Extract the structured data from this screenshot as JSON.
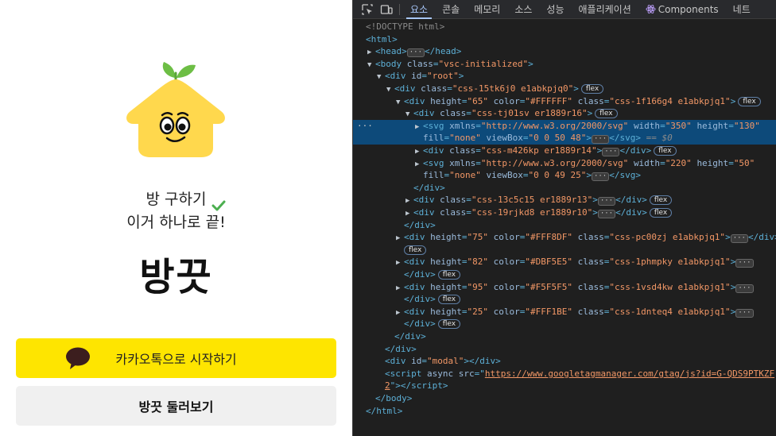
{
  "app": {
    "tagline_line1": "방 구하기",
    "tagline_line2": "이거 하나로 끝!",
    "brand": "방끗",
    "kakao_button": "카카오톡으로 시작하기",
    "browse_button": "방끗 둘러보기",
    "colors": {
      "kakao": "#FEE500",
      "logo": "#FFD84D",
      "leaf": "#6DBE45",
      "check": "#4CAF50"
    }
  },
  "devtools": {
    "tabs": [
      "요소",
      "콘솔",
      "메모리",
      "소스",
      "성능",
      "애플리케이션",
      "Components",
      "네트"
    ],
    "active_tab": "요소",
    "flex_badge": "flex",
    "selected_suffix": " == $0"
  }
}
